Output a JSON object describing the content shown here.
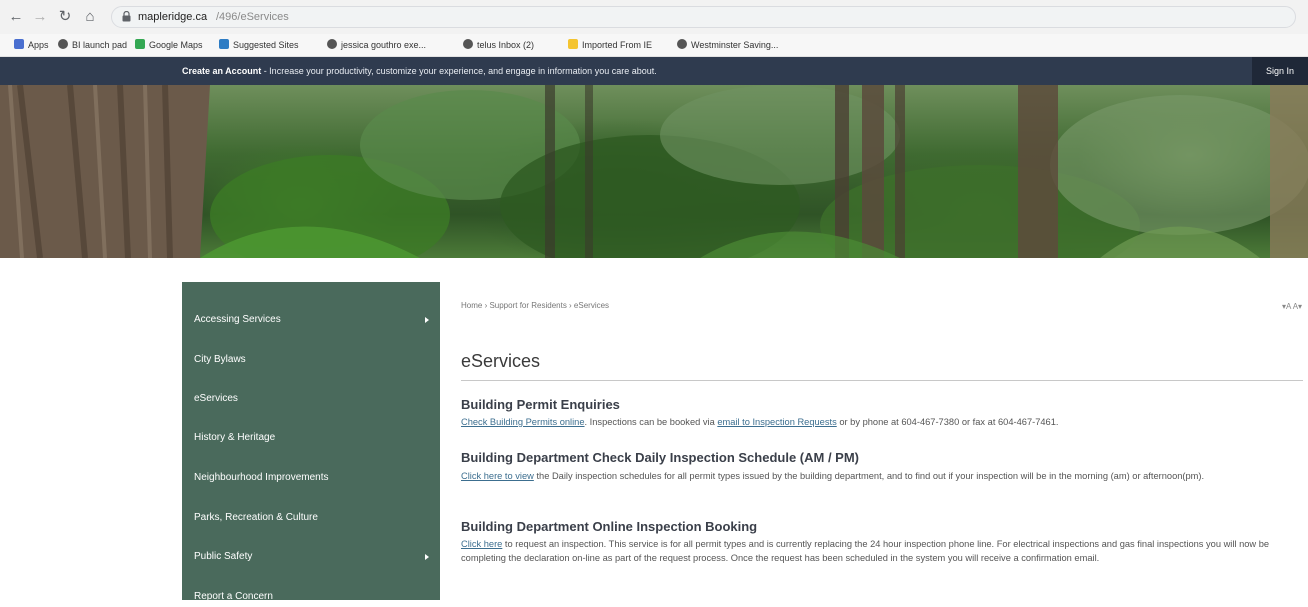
{
  "browser": {
    "url_host": "mapleridge.ca",
    "url_path": "/496/eServices",
    "bookmarks": [
      {
        "label": "Apps",
        "color": "#4a6fd0"
      },
      {
        "label": "BI launch pad",
        "color": "#555555"
      },
      {
        "label": "Google Maps",
        "color": "#34a853"
      },
      {
        "label": "Suggested Sites",
        "color": "#2d7cc4"
      },
      {
        "label": "jessica gouthro exe...",
        "color": "#555555"
      },
      {
        "label": "telus Inbox (2)",
        "color": "#555555"
      },
      {
        "label": "Imported From IE",
        "color": "#f4c430"
      },
      {
        "label": "Westminster Saving...",
        "color": "#555555"
      }
    ]
  },
  "site_bar": {
    "account_title": "Create an Account",
    "account_msg": " - Increase your productivity, customize your experience, and engage in information you care about.",
    "sign_in": "Sign In"
  },
  "sidebar": {
    "items": [
      {
        "label": "Accessing Services",
        "has_arrow": true
      },
      {
        "label": "City Bylaws",
        "has_arrow": false
      },
      {
        "label": "eServices",
        "has_arrow": false
      },
      {
        "label": "History & Heritage",
        "has_arrow": false
      },
      {
        "label": "Neighbourhood Improvements",
        "has_arrow": false
      },
      {
        "label": "Parks, Recreation & Culture",
        "has_arrow": false
      },
      {
        "label": "Public Safety",
        "has_arrow": true
      },
      {
        "label": "Report a Concern",
        "has_arrow": false
      }
    ]
  },
  "main": {
    "breadcrumb": "Home › Support for Residents › eServices",
    "text_size": "▾A A▾",
    "title": "eServices",
    "sections": [
      {
        "heading": "Building Permit Enquiries",
        "link1": "Check Building Permits online",
        "text1": ". Inspections can be booked via ",
        "link2": "email to Inspection Requests",
        "text2": " or by phone at 604-467-7380 or fax at 604-467-7461."
      },
      {
        "heading": "Building Department Check Daily Inspection Schedule (AM / PM)",
        "link1": "Click here to view",
        "text1": " the Daily inspection schedules for all permit types issued by the building department, and to find out if your inspection will be in the morning (am) or afternoon(pm)."
      },
      {
        "heading": "Building Department Online Inspection Booking",
        "link1": "Click here",
        "text1": " to request an inspection. This service is for all permit types and is currently replacing the 24 hour inspection phone line. For electrical inspections and gas final inspections you will now be completing the declaration on-line as part of the request process. Once the request has been scheduled in the system you will receive a confirmation email."
      }
    ]
  }
}
